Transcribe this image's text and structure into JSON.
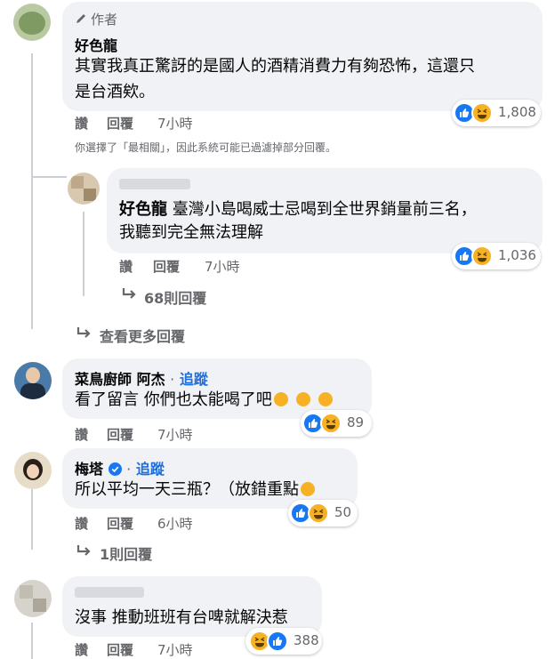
{
  "comments": {
    "main": {
      "author_badge": "作者",
      "name": "好色龍",
      "text_line1": "其實我真正驚訝的是國人的酒精消費力有夠恐怖，這還只",
      "text_line2": "是台酒欸。",
      "like_label": "讚",
      "reply_label": "回覆",
      "time": "7小時",
      "reaction_count": "1,808"
    },
    "filter_notice": "你選擇了「最相關」，因此系統可能已過濾掉部分回覆。",
    "reply1": {
      "mention": "好色龍",
      "text_line1": "臺灣小島喝威士忌喝到全世界銷量前三名，",
      "text_line2": "我聽到完全無法理解",
      "like_label": "讚",
      "reply_label": "回覆",
      "time": "7小時",
      "reaction_count": "1,036",
      "more_replies": "68則回覆"
    },
    "view_more": "查看更多回覆",
    "c2": {
      "name": "菜鳥廚師 阿杰",
      "dot": "·",
      "follow": "追蹤",
      "text": "看了留言 你們也太能喝了吧",
      "like_label": "讚",
      "reply_label": "回覆",
      "time": "7小時",
      "reaction_count": "89"
    },
    "c3": {
      "name": "梅塔",
      "dot": "·",
      "follow": "追蹤",
      "text": "所以平均一天三瓶？（放錯重點",
      "like_label": "讚",
      "reply_label": "回覆",
      "time": "6小時",
      "reaction_count": "50",
      "more_replies": "1則回覆"
    },
    "c4": {
      "text": "沒事 推動班班有台啤就解決惹",
      "like_label": "讚",
      "reply_label": "回覆",
      "time": "7小時",
      "reaction_count": "388"
    }
  },
  "icons": {
    "author": "pencil-icon",
    "like": "like-icon",
    "haha": "haha-icon",
    "verified": "verified-icon",
    "reply_arrow": "reply-arrow-icon",
    "laughing_emoji": "grinning-squinting-emoji",
    "tears_emoji": "tears-of-joy-emoji"
  },
  "colors": {
    "bubble": "#f0f2f5",
    "like_blue": "#1877f2",
    "haha_yellow": "#f7b125",
    "secondary_text": "#65676b",
    "follow_blue": "#216fdb"
  }
}
